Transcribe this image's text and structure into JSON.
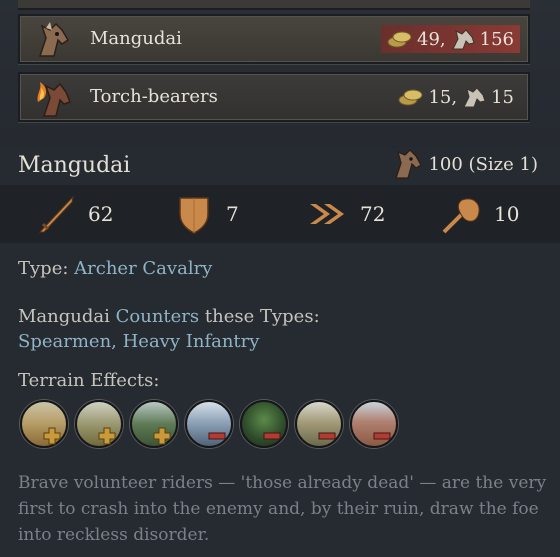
{
  "units": [
    {
      "name": "Mangudai",
      "gold": "49,",
      "horses": "156",
      "highlight": true
    },
    {
      "name": "Torch-bearers",
      "gold": "15,",
      "horses": "15",
      "highlight": false
    }
  ],
  "detail": {
    "title": "Mangudai",
    "size_text": "100 (Size 1)",
    "stats": {
      "damage": "62",
      "toughness": "7",
      "pursuit": "72",
      "screen": "10"
    },
    "type_label": "Type:",
    "type_value": "Archer Cavalry",
    "counters_prefix": "Mangudai",
    "counters_word": "Counters",
    "counters_suffix": "these Types:",
    "counters_list": "Spearmen, Heavy Infantry",
    "terrain_label": "Terrain Effects:",
    "terrains": [
      {
        "name": "plains",
        "effect": "plus"
      },
      {
        "name": "farmlands",
        "effect": "plus"
      },
      {
        "name": "hills",
        "effect": "plus"
      },
      {
        "name": "mountains",
        "effect": "minus"
      },
      {
        "name": "forest",
        "effect": "minus"
      },
      {
        "name": "wetlands",
        "effect": "minus"
      },
      {
        "name": "desert-mountains",
        "effect": "minus"
      }
    ],
    "description": "Brave volunteer riders — 'those already dead' — are the very first to crash into the enemy and, by their ruin, draw the foe into reckless disorder."
  },
  "colors": {
    "plus": "#c99a3a",
    "minus": "#b23b34",
    "link": "#8fb4c8"
  }
}
